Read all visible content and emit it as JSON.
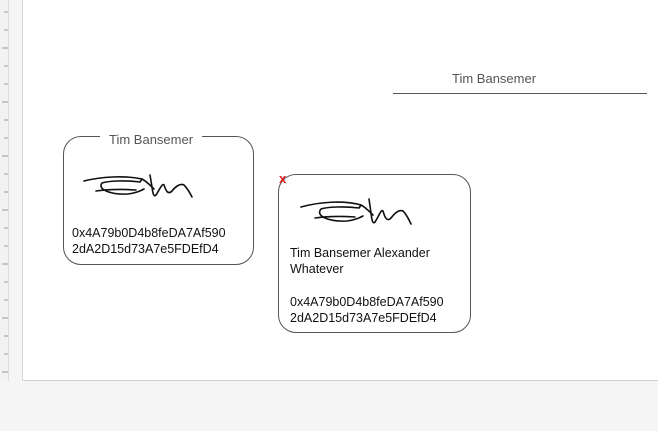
{
  "signature_line": {
    "name": "Tim Bansemer"
  },
  "signature_card": {
    "title": "Tim Bansemer",
    "address_line1": "0x4A79b0D4b8feDA7Af590",
    "address_line2": "2dA2D15d73A7e5FDEfD4"
  },
  "selected_signature_card": {
    "remove_label": "x",
    "full_name": "Tim Bansemer Alexander Whatever",
    "address_line1": "0x4A79b0D4b8feDA7Af590",
    "address_line2": "2dA2D15d73A7e5FDEfD4"
  },
  "colors": {
    "remove": "#e02020",
    "border": "#555555"
  }
}
